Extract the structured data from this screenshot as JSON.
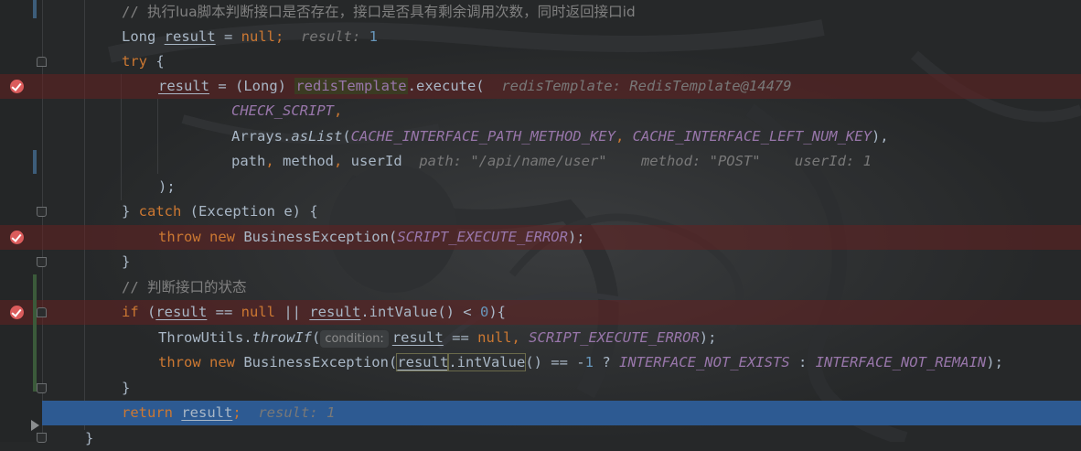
{
  "editor": {
    "lines": [
      {
        "id": "l1",
        "tokens": [
          {
            "t": "// ",
            "c": "cm"
          },
          {
            "t": "执行lua脚本判断接口是否存在，接口是否具有剩余调用次数，同时返回接口id",
            "c": "cm-cjk"
          }
        ]
      },
      {
        "id": "l2",
        "tokens": [
          {
            "t": "Long ",
            "c": "plain"
          },
          {
            "t": "result",
            "c": "var"
          },
          {
            "t": " = ",
            "c": "plain"
          },
          {
            "t": "null",
            "c": "kw"
          },
          {
            "t": ";  ",
            "c": "kw"
          },
          {
            "t": "result: ",
            "c": "hint"
          },
          {
            "t": "1",
            "c": "num"
          }
        ]
      },
      {
        "id": "l3",
        "tokens": [
          {
            "t": "try ",
            "c": "kw"
          },
          {
            "t": "{",
            "c": "plain"
          }
        ]
      },
      {
        "id": "l4",
        "tokens": [
          {
            "t": "result",
            "c": "var"
          },
          {
            "t": " = (Long) ",
            "c": "plain"
          },
          {
            "t": "redisTemplate",
            "c": "fld hl"
          },
          {
            "t": ".execute(  ",
            "c": "plain"
          },
          {
            "t": "redisTemplate: RedisTemplate@14479",
            "c": "hint"
          }
        ]
      },
      {
        "id": "l5",
        "tokens": [
          {
            "t": "CHECK_SCRIPT",
            "c": "const"
          },
          {
            "t": ",",
            "c": "kw"
          }
        ]
      },
      {
        "id": "l6",
        "tokens": [
          {
            "t": "Arrays.",
            "c": "plain"
          },
          {
            "t": "asList",
            "c": "static"
          },
          {
            "t": "(",
            "c": "plain"
          },
          {
            "t": "CACHE_INTERFACE_PATH_METHOD_KEY",
            "c": "const"
          },
          {
            "t": ", ",
            "c": "kw"
          },
          {
            "t": "CACHE_INTERFACE_LEFT_NUM_KEY",
            "c": "const"
          },
          {
            "t": "),",
            "c": "plain"
          }
        ]
      },
      {
        "id": "l7",
        "tokens": [
          {
            "t": "path",
            "c": "plain"
          },
          {
            "t": ", ",
            "c": "kw"
          },
          {
            "t": "method",
            "c": "plain"
          },
          {
            "t": ", ",
            "c": "kw"
          },
          {
            "t": "userId  ",
            "c": "plain"
          },
          {
            "t": "path: \"/api/name/user\"    method: \"POST\"    userId: 1",
            "c": "hint"
          }
        ]
      },
      {
        "id": "l8",
        "tokens": [
          {
            "t": ");",
            "c": "plain"
          }
        ]
      },
      {
        "id": "l9",
        "tokens": [
          {
            "t": "} ",
            "c": "plain"
          },
          {
            "t": "catch ",
            "c": "kw"
          },
          {
            "t": "(Exception e) {",
            "c": "plain"
          }
        ]
      },
      {
        "id": "l10",
        "tokens": [
          {
            "t": "throw new ",
            "c": "kw"
          },
          {
            "t": "BusinessException(",
            "c": "plain"
          },
          {
            "t": "SCRIPT_EXECUTE_ERROR",
            "c": "const"
          },
          {
            "t": ");",
            "c": "plain"
          }
        ]
      },
      {
        "id": "l11",
        "tokens": [
          {
            "t": "}",
            "c": "plain"
          }
        ]
      },
      {
        "id": "l12",
        "tokens": [
          {
            "t": "// ",
            "c": "cm"
          },
          {
            "t": "判断接口的状态",
            "c": "cm-cjk"
          }
        ]
      },
      {
        "id": "l13",
        "tokens": [
          {
            "t": "if ",
            "c": "kw"
          },
          {
            "t": "(",
            "c": "plain"
          },
          {
            "t": "result",
            "c": "var"
          },
          {
            "t": " == ",
            "c": "plain"
          },
          {
            "t": "null",
            "c": "kw"
          },
          {
            "t": " || ",
            "c": "plain"
          },
          {
            "t": "result",
            "c": "var"
          },
          {
            "t": ".intValue() < ",
            "c": "plain"
          },
          {
            "t": "0",
            "c": "num"
          },
          {
            "t": "){",
            "c": "plain"
          }
        ]
      },
      {
        "id": "l14",
        "tokens": [
          {
            "t": "ThrowUtils.",
            "c": "plain"
          },
          {
            "t": "throwIf",
            "c": "static"
          },
          {
            "t": "(",
            "c": "plain"
          },
          {
            "t": "condition:",
            "c": "pill"
          },
          {
            "t": "result",
            "c": "var"
          },
          {
            "t": " == ",
            "c": "plain"
          },
          {
            "t": "null",
            "c": "kw"
          },
          {
            "t": ", ",
            "c": "kw"
          },
          {
            "t": "SCRIPT_EXECUTE_ERROR",
            "c": "const"
          },
          {
            "t": ");",
            "c": "plain"
          }
        ]
      },
      {
        "id": "l15",
        "tokens": [
          {
            "t": "throw new ",
            "c": "kw"
          },
          {
            "t": "BusinessException(",
            "c": "plain"
          },
          {
            "t": "result",
            "c": "var hl2"
          },
          {
            "t": ".intValue",
            "c": "plain hl2"
          },
          {
            "t": "() == -",
            "c": "plain"
          },
          {
            "t": "1",
            "c": "num"
          },
          {
            "t": " ? ",
            "c": "plain"
          },
          {
            "t": "INTERFACE_NOT_EXISTS",
            "c": "const"
          },
          {
            "t": " : ",
            "c": "plain"
          },
          {
            "t": "INTERFACE_NOT_REMAIN",
            "c": "const"
          },
          {
            "t": ");",
            "c": "plain"
          }
        ]
      },
      {
        "id": "l16",
        "tokens": [
          {
            "t": "}",
            "c": "plain"
          }
        ]
      },
      {
        "id": "l17",
        "tokens": [
          {
            "t": "return ",
            "c": "kw"
          },
          {
            "t": "result",
            "c": "var"
          },
          {
            "t": ";  ",
            "c": "kw"
          },
          {
            "t": "result: 1",
            "c": "hint"
          }
        ]
      },
      {
        "id": "l18",
        "tokens": [
          {
            "t": "}",
            "c": "plain"
          }
        ]
      }
    ]
  },
  "colors": {
    "background": "#262829",
    "keyword": "#cc7832",
    "constant": "#9876aa",
    "breakpoint": "#db5c5c",
    "current_line": "#2d5a92"
  },
  "icons": [
    "breakpoint-icon",
    "fold-marker-icon",
    "execution-point-icon"
  ]
}
